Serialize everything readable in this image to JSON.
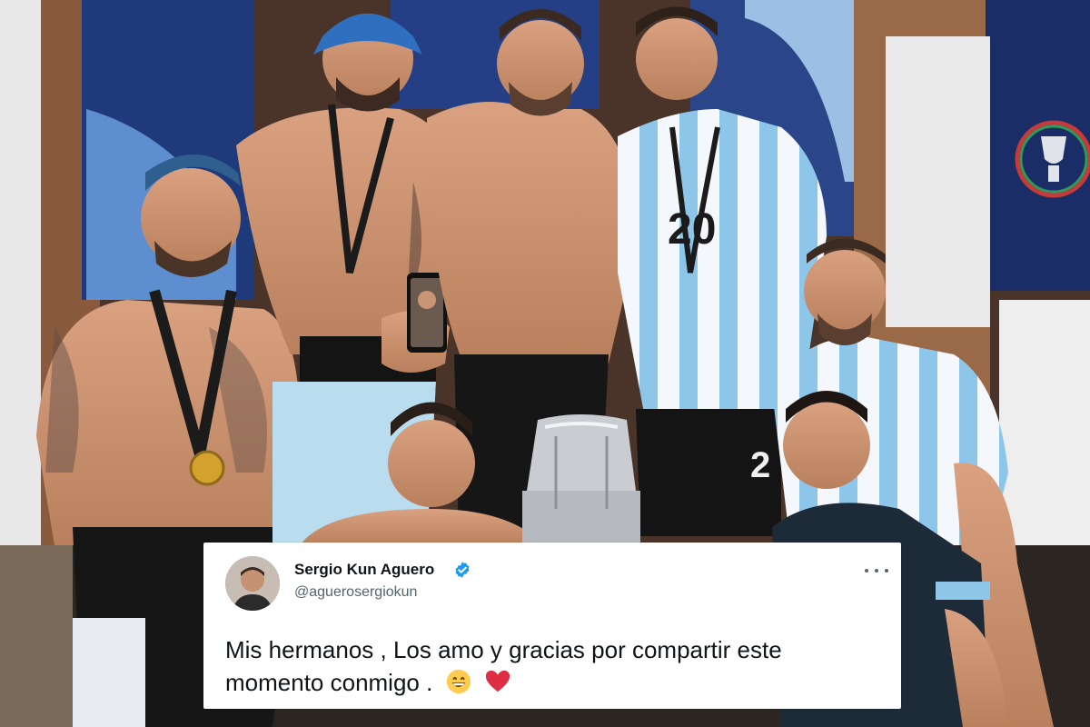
{
  "tweet": {
    "author_name": "Sergio Kun Aguero",
    "handle": "@aguerosergiokun",
    "text": "Mis hermanos , Los amo y gracias por compartir este momento conmigo .",
    "emojis": [
      "grinning-face-icon",
      "red-heart-icon"
    ]
  },
  "photo": {
    "jersey_numbers": [
      "20",
      "2"
    ]
  },
  "colors": {
    "verified_blue": "#1d9bf0",
    "heart_red": "#e0245e",
    "jersey_sky_blue": "#8ec6ea"
  }
}
